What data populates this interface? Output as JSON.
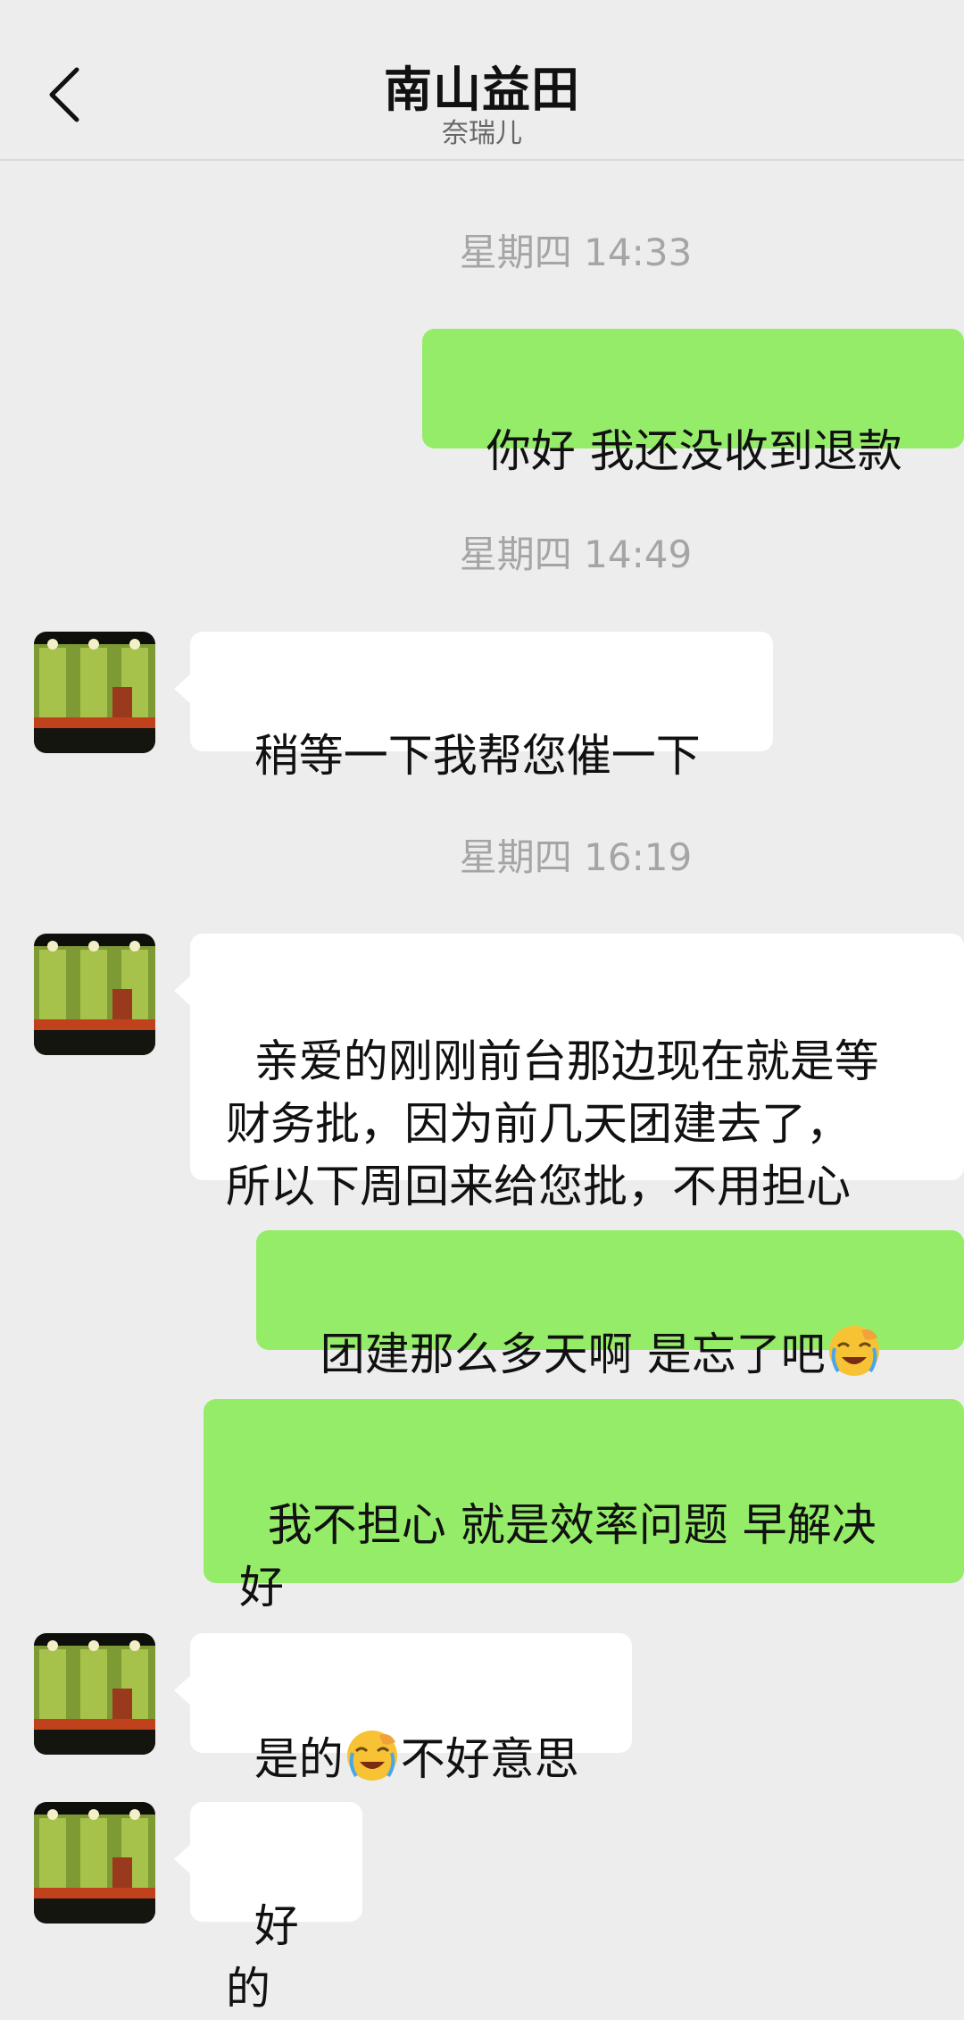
{
  "header": {
    "title": "南山益田",
    "subtitle": "奈瑞儿"
  },
  "icons": {
    "back": "chevron-left-icon",
    "avatar": "contact-avatar",
    "emoji": "facepalm-laugh-emoji"
  },
  "colors": {
    "background": "#ededed",
    "incoming_bubble": "#ffffff",
    "outgoing_bubble": "#95ec69",
    "timestamp": "#a5a5a5"
  },
  "messages": {
    "ts1": "星期四 14:33",
    "m1": "你好 我还没收到退款",
    "ts2": "星期四 14:49",
    "m2": "稍等一下我帮您催一下",
    "ts3": "星期四 16:19",
    "m3": "亲爱的刚刚前台那边现在就是等\n财务批，因为前几天团建去了，\n所以下周回来给您批，不用担心",
    "m4": "团建那么多天啊 是忘了吧",
    "m5": "我不担心 就是效率问题 早解决\n好",
    "m6a": "是的",
    "m6b": "不好意思",
    "m7": "好的"
  }
}
